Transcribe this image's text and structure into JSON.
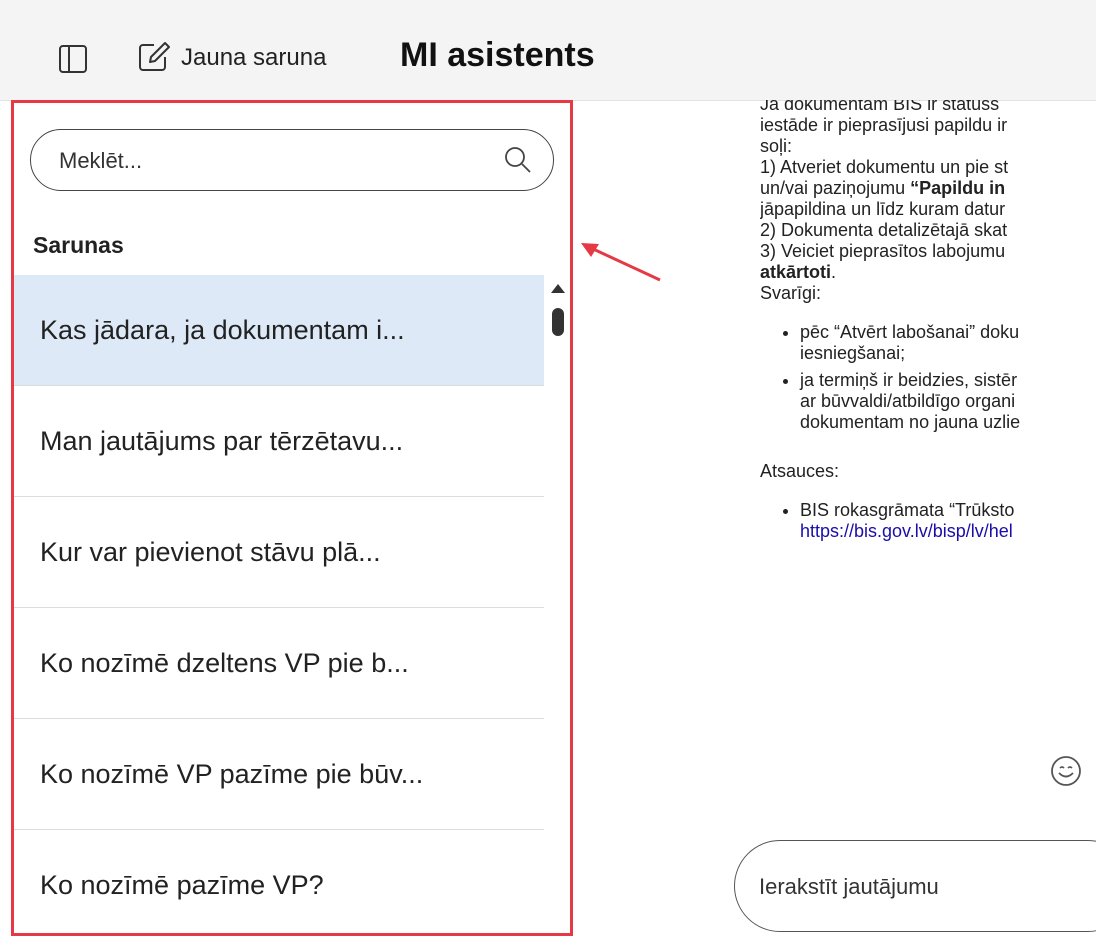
{
  "header": {
    "new_chat_label": "Jauna saruna",
    "title": "MI asistents",
    "sidebar_toggle_icon": "sidebar-toggle-icon",
    "new_chat_icon": "edit-icon"
  },
  "sidebar": {
    "search_placeholder": "Meklēt...",
    "section_label": "Sarunas",
    "highlight_color": "#e53945",
    "active_color": "#dde9f7",
    "items": [
      {
        "label": "Kas jādara, ja dokumentam i..."
      },
      {
        "label": "Man jautājums par tērzētavu..."
      },
      {
        "label": "Kur var pievienot stāvu plā..."
      },
      {
        "label": "Ko nozīmē dzeltens VP pie b..."
      },
      {
        "label": "Ko nozīmē VP pazīme pie būv..."
      },
      {
        "label": "Ko nozīmē pazīme VP?"
      }
    ]
  },
  "message": {
    "lines": [
      "Ja dokumentam BIS ir statuss",
      "iestāde ir pieprasījusi papildu ir",
      "soļi:",
      "1) Atveriet dokumentu un pie st",
      "un/vai paziņojumu "
    ],
    "bold_inline": "“Papildu in",
    "lines2": [
      "jāpapildina un līdz kuram datur",
      "2) Dokumenta detalizētajā skat",
      "3) Veiciet pieprasītos labojumu"
    ],
    "bold_line": "atkārtoti",
    "bold_line_suffix": ".",
    "important_label": "Svarīgi:",
    "bullets": [
      [
        "pēc “Atvērt labošanai” doku",
        "iesniegšanai;"
      ],
      [
        "ja termiņš ir beidzies, sistēr",
        "ar būvvaldi/atbildīgo organi",
        "dokumentam no jauna uzlie"
      ]
    ],
    "references_label": "Atsauces:",
    "reference_title": "BIS rokasgrāmata “Trūksto",
    "reference_link": "https://bis.gov.lv/bisp/lv/hel"
  },
  "composer": {
    "placeholder": "Ierakstīt jautājumu"
  }
}
